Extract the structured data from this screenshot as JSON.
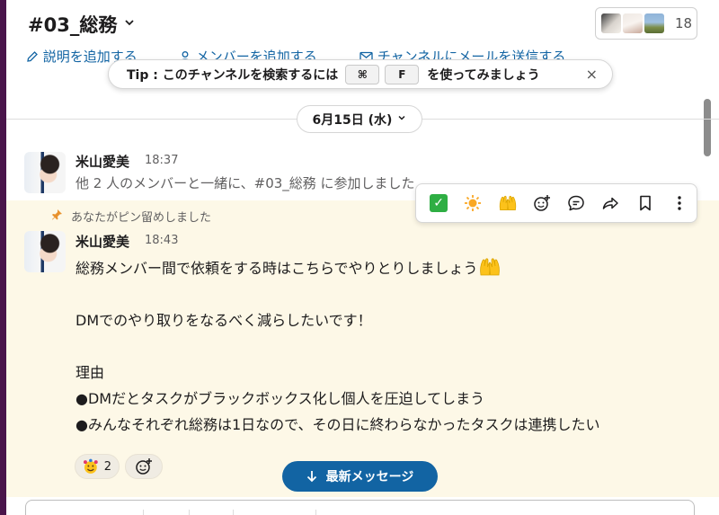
{
  "channel": {
    "title": "#03_総務",
    "member_count": "18"
  },
  "bookmarks": {
    "add_description": "説明を追加する",
    "add_member": "メンバーを追加する",
    "send_email": "チャンネルにメールを送信する"
  },
  "tip": {
    "prefix": "Tip : このチャンネルを検索するには",
    "key1": "⌘",
    "key2": "F",
    "suffix": "を使ってみましょう",
    "close": "×"
  },
  "date_divider": {
    "label": "6月15日 (水)"
  },
  "messages": [
    {
      "author": "米山愛美",
      "time": "18:37",
      "body": "他 2 人のメンバーと一緒に、#03_総務 に参加しました"
    },
    {
      "pinned_notice": "あなたがピン留めしました",
      "author": "米山愛美",
      "time": "18:43",
      "lines": [
        "総務メンバー間で依頼をする時はこちらでやりとりしましょう",
        "",
        "DMでのやり取りをなるべく減らしたいです！",
        "",
        "理由",
        "●DMだとタスクがブラックボックス化し個人を圧迫してしまう",
        "●みんなそれぞれ総務は1日なので、その日に終わらなかったタスクは連携したい"
      ],
      "reactions": [
        {
          "emoji": "smiling-face-with-hearts",
          "count": "2"
        }
      ]
    }
  ],
  "toolbar": {
    "icons": [
      "check-mark-emoji",
      "sun-emoji",
      "raised-hands-emoji",
      "add-reaction-icon",
      "reply-thread-icon",
      "share-icon",
      "bookmark-icon",
      "more-icon"
    ]
  },
  "new_messages": {
    "label": "最新メッセージ"
  },
  "colors": {
    "sidebar": "#4a154b",
    "link": "#1264a3",
    "pinned_bg": "#fdf8e7",
    "primary_button": "#1264a3"
  }
}
